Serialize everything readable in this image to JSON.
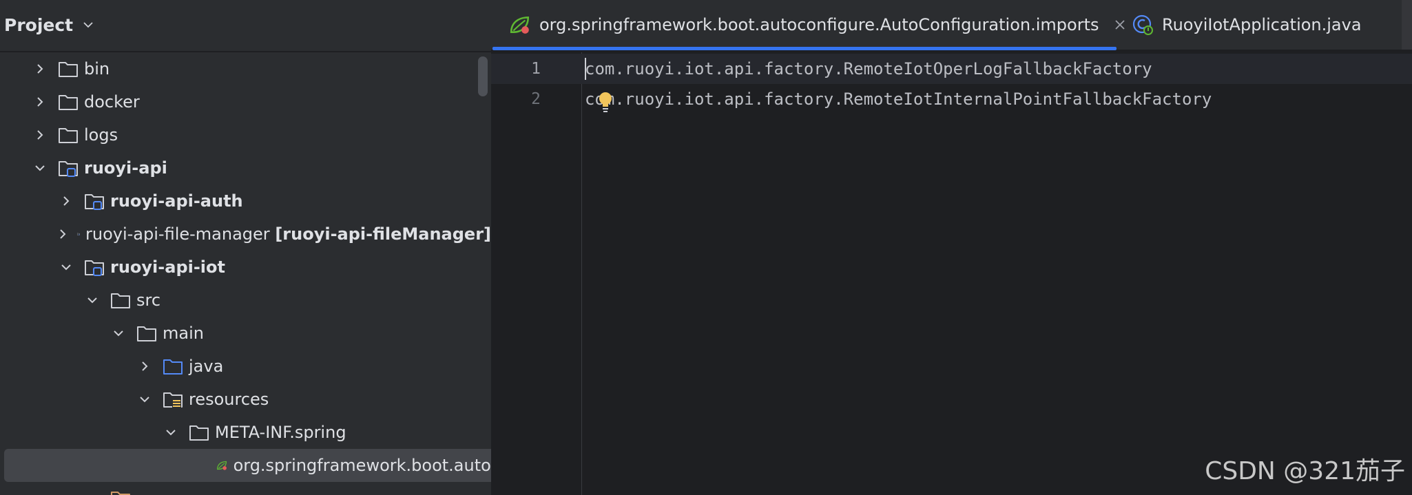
{
  "project_panel": {
    "title": "Project",
    "tree": [
      {
        "label": "bin",
        "expanded": false,
        "icon": "folder-icon",
        "bold": false
      },
      {
        "label": "docker",
        "expanded": false,
        "icon": "folder-icon",
        "bold": false
      },
      {
        "label": "logs",
        "expanded": false,
        "icon": "folder-icon",
        "bold": false
      },
      {
        "label": "ruoyi-api",
        "expanded": true,
        "icon": "module-folder-icon",
        "bold": true
      },
      {
        "label": "ruoyi-api-auth",
        "expanded": false,
        "icon": "module-folder-icon",
        "bold": true
      },
      {
        "label": "ruoyi-api-file-manager",
        "suffix": "[ruoyi-api-fileManager]",
        "expanded": false,
        "icon": "module-folder-icon",
        "bold": false
      },
      {
        "label": "ruoyi-api-iot",
        "expanded": true,
        "icon": "module-folder-icon",
        "bold": true
      },
      {
        "label": "src",
        "expanded": true,
        "icon": "folder-icon",
        "bold": false
      },
      {
        "label": "main",
        "expanded": true,
        "icon": "folder-icon",
        "bold": false
      },
      {
        "label": "java",
        "expanded": false,
        "icon": "source-folder-icon",
        "bold": false
      },
      {
        "label": "resources",
        "expanded": true,
        "icon": "resources-folder-icon",
        "bold": false
      },
      {
        "label": "META-INF.spring",
        "expanded": true,
        "icon": "folder-icon",
        "bold": false
      },
      {
        "label": "org.springframework.boot.autoc",
        "icon": "spring-file-icon",
        "bold": false,
        "selected": true
      }
    ]
  },
  "editor": {
    "tabs": [
      {
        "label": "org.springframework.boot.autoconfigure.AutoConfiguration.imports",
        "icon": "spring-file-icon",
        "active": true
      },
      {
        "label": "RuoyiIotApplication.java",
        "icon": "spring-boot-class-icon",
        "active": false
      }
    ],
    "lines": [
      {
        "number": "1",
        "text": "com.ruoyi.iot.api.factory.RemoteIotOperLogFallbackFactory"
      },
      {
        "number": "2",
        "text": "com.ruoyi.iot.api.factory.RemoteIotInternalPointFallbackFactory"
      }
    ]
  },
  "watermark": "CSDN @321茄子",
  "colors": {
    "panel_bg": "#2b2d30",
    "editor_bg": "#1e1f22",
    "accent": "#3574f0",
    "spring_green": "#5fb832",
    "bulb_yellow": "#f2c55c"
  }
}
